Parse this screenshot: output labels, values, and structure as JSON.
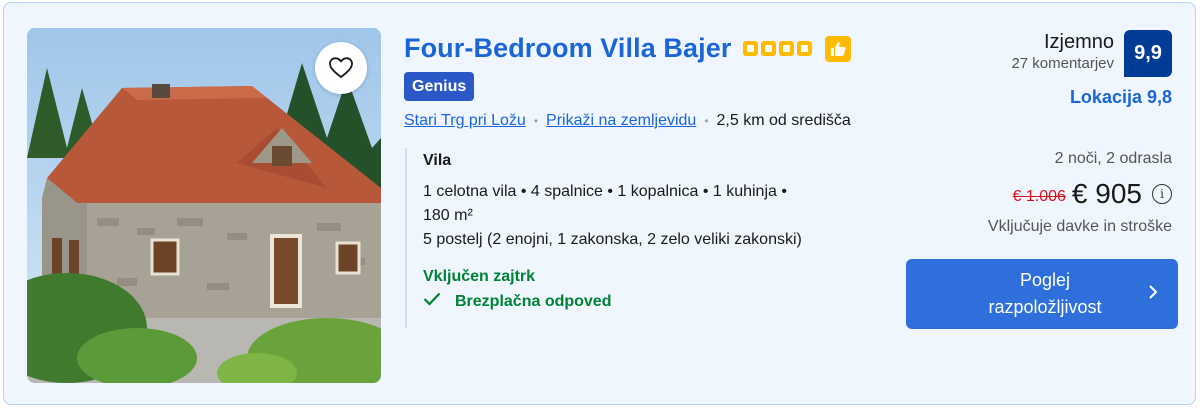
{
  "listing": {
    "title": "Four-Bedroom Villa Bajer",
    "star_count": 4,
    "genius_label": "Genius",
    "location_link": "Stari Trg pri Ložu",
    "map_link": "Prikaži na zemljevidu",
    "distance": "2,5 km od središča",
    "unit_type": "Vila",
    "unit_line1": "1 celotna vila • 4 spalnice • 1 kopalnica • 1 kuhinja •",
    "unit_line2": "180 m²",
    "beds": "5 postelj (2 enojni, 1 zakonska, 2 zelo veliki zakonski)",
    "breakfast": "Vključen zajtrk",
    "cancellation": "Brezplačna odpoved"
  },
  "review": {
    "word": "Izjemno",
    "count": "27 komentarjev",
    "score": "9,9",
    "location_score": "Lokacija 9,8"
  },
  "pricing": {
    "stay": "2 noči, 2 odrasla",
    "old_price": "€ 1.006",
    "price": "€ 905",
    "taxes": "Vključuje davke in stroške",
    "cta_line1": "Poglej",
    "cta_line2": "razpoložljivost"
  },
  "icons": {
    "favorite": "heart-icon",
    "thumb": "thumbs-up-icon",
    "info": "info-icon",
    "check": "check-icon",
    "chevron": "chevron-right-icon"
  },
  "colors": {
    "brand_blue": "#1a66d6",
    "score_bg": "#003b95",
    "genius_bg": "#2b58c7",
    "star_yellow": "#febb02",
    "green": "#008234",
    "red": "#d4111e",
    "card_bg": "#f0f6ff"
  }
}
